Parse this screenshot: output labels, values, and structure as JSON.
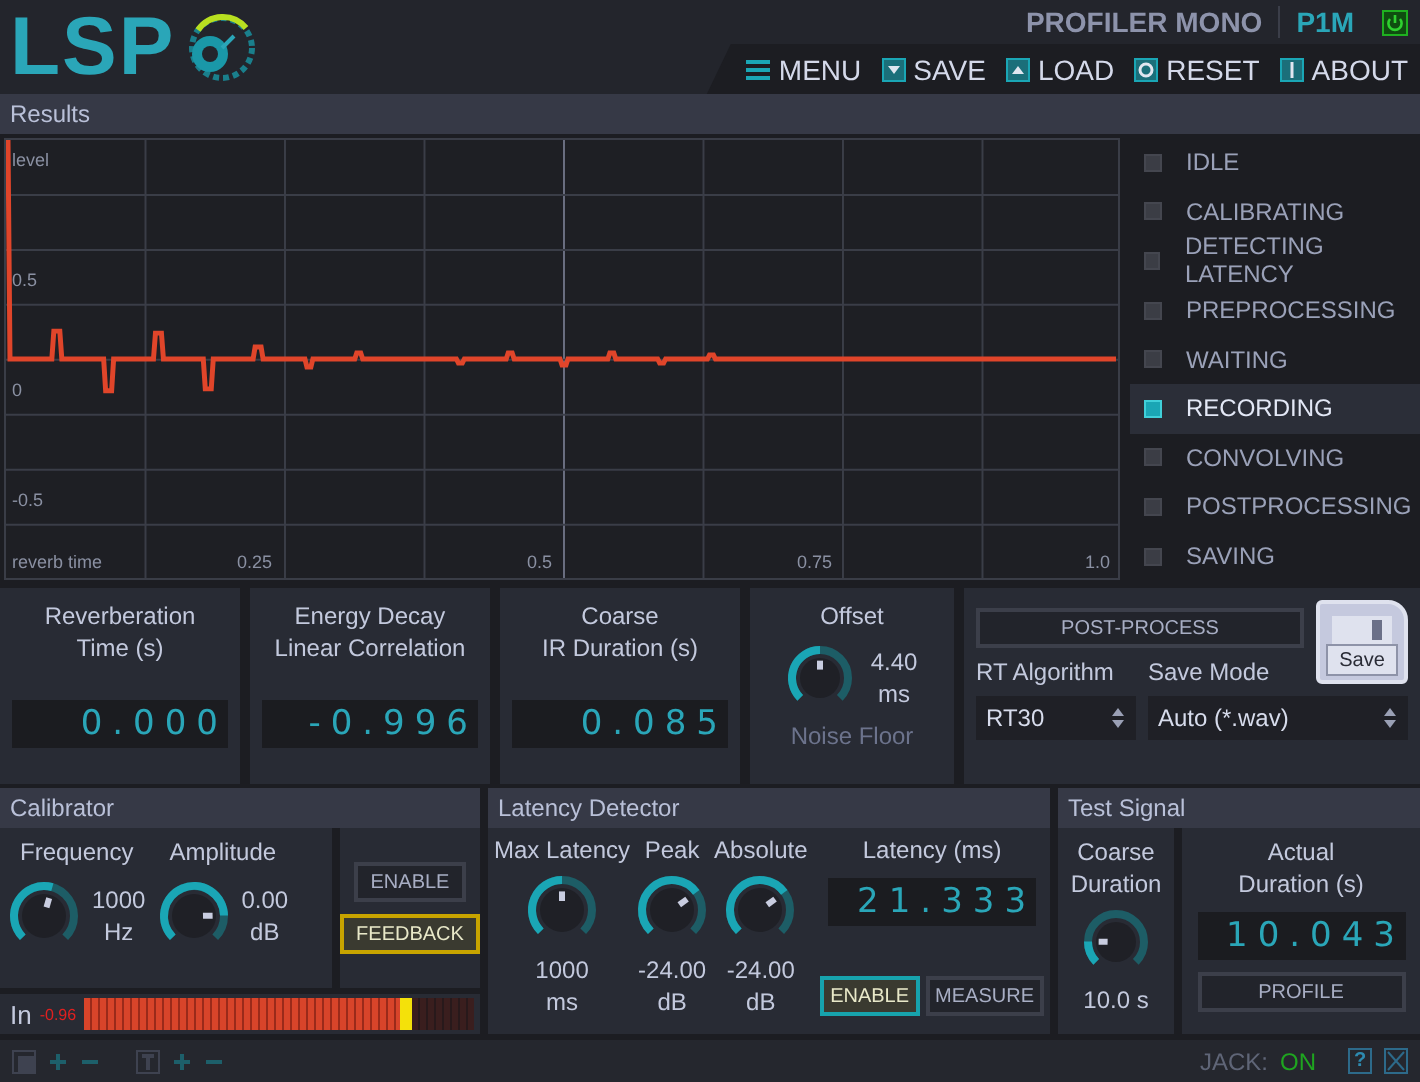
{
  "header": {
    "logo": "LSP",
    "plugin_name": "PROFILER MONO",
    "plugin_id": "P1M",
    "power_on": true,
    "menu": [
      {
        "kind": "menu",
        "label": "MENU"
      },
      {
        "kind": "save",
        "label": "SAVE"
      },
      {
        "kind": "load",
        "label": "LOAD"
      },
      {
        "kind": "reset",
        "label": "RESET"
      },
      {
        "kind": "about",
        "label": "ABOUT"
      }
    ]
  },
  "results": {
    "title": "Results",
    "graph": {
      "y_label": "level",
      "y_ticks": [
        "0.5",
        "0",
        "-0.5"
      ],
      "x_label": "reverb time",
      "x_ticks": [
        "0.25",
        "0.5",
        "0.75",
        "1.0"
      ]
    },
    "states": [
      {
        "label": "IDLE",
        "selected": false
      },
      {
        "label": "CALIBRATING",
        "selected": false
      },
      {
        "label": "DETECTING LATENCY",
        "selected": false
      },
      {
        "label": "PREPROCESSING",
        "selected": false
      },
      {
        "label": "WAITING",
        "selected": false
      },
      {
        "label": "RECORDING",
        "selected": true
      },
      {
        "label": "CONVOLVING",
        "selected": false
      },
      {
        "label": "POSTPROCESSING",
        "selected": false
      },
      {
        "label": "SAVING",
        "selected": false
      }
    ]
  },
  "measures": [
    {
      "label_lines": [
        "Reverberation",
        "Time (s)"
      ],
      "value": "0.000"
    },
    {
      "label_lines": [
        "Energy Decay",
        "Linear Correlation"
      ],
      "value": "-0.996"
    },
    {
      "label_lines": [
        "Coarse",
        "IR Duration (s)"
      ],
      "value": "0.085"
    }
  ],
  "offset": {
    "title": "Offset",
    "level": 0.5,
    "value": "4.40",
    "unit": "ms",
    "caption": "Noise Floor"
  },
  "post": {
    "post_process": {
      "label": "POST-PROCESS",
      "on": false
    },
    "save": {
      "label": "Save"
    },
    "rt_algorithm": {
      "label": "RT Algorithm",
      "value": "RT30"
    },
    "save_mode": {
      "label": "Save Mode",
      "value": "Auto (*.wav)"
    }
  },
  "calibrator": {
    "title": "Calibrator",
    "knobs": [
      {
        "label": "Frequency",
        "level": 0.56,
        "value": "1000",
        "unit": "Hz"
      },
      {
        "label": "Amplitude",
        "level": 0.83,
        "value": "0.00",
        "unit": "dB"
      }
    ],
    "buttons": [
      {
        "label": "ENABLE",
        "on": false
      },
      {
        "label": "FEEDBACK",
        "on": true,
        "color": "#c8a400"
      }
    ],
    "meter": {
      "label": "In",
      "reading": "-0.96",
      "level": 0.84
    }
  },
  "latency": {
    "title": "Latency Detector",
    "knobs": [
      {
        "label": "Max Latency",
        "level": 0.5,
        "value": "1000",
        "unit": "ms"
      },
      {
        "label": "Peak",
        "level": 0.7,
        "value": "-24.00",
        "unit": "dB"
      },
      {
        "label": "Absolute",
        "level": 0.7,
        "value": "-24.00",
        "unit": "dB"
      }
    ],
    "readout": {
      "label": "Latency (ms)",
      "value": "21.333"
    },
    "buttons": [
      {
        "label": "ENABLE",
        "on": true,
        "color": "#17a3ad"
      },
      {
        "label": "MEASURE",
        "on": false
      }
    ]
  },
  "test_signal": {
    "title": "Test Signal",
    "knob": {
      "label_lines": [
        "Coarse",
        "Duration"
      ],
      "level": 0.17,
      "value": "10.0 s"
    },
    "readout": {
      "label_lines": [
        "Actual",
        "Duration (s)"
      ],
      "value": "10.043"
    },
    "profile": {
      "label": "PROFILE",
      "on": false
    }
  },
  "footer": {
    "jack_label": "JACK:",
    "jack_status": "ON",
    "jack_on": true,
    "help_glyph": "?"
  }
}
